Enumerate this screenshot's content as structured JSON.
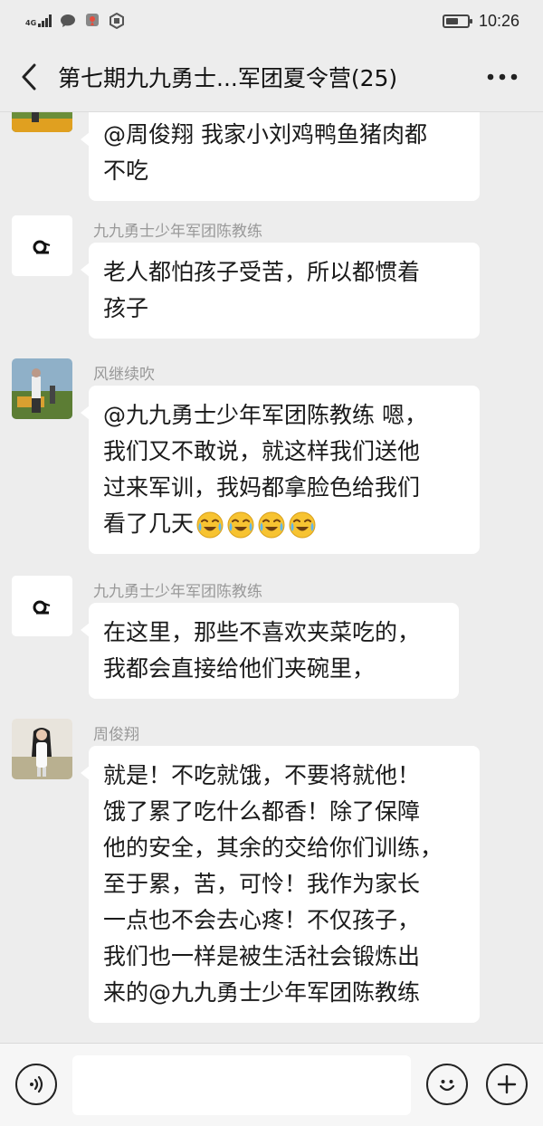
{
  "status_bar": {
    "network_type": "4G",
    "time": "10:26",
    "battery_level": 0.6
  },
  "header": {
    "title": "第七期九九勇士...军团夏令营(25)",
    "back_icon": "chevron-left-icon",
    "more_icon": "more-dots-icon"
  },
  "messages": [
    {
      "sender": "",
      "avatar": "photo-avatar-man",
      "lines": [
        "@周俊翔  我家小刘鸡鸭鱼猪肉都",
        "不吃"
      ]
    },
    {
      "sender": "九九勇士少年军团陈教练",
      "avatar": "logo-avatar",
      "lines": [
        "老人都怕孩子受苦，所以都惯着",
        "孩子"
      ]
    },
    {
      "sender": "风继续吹",
      "avatar": "photo-avatar-man",
      "lines": [
        "@九九勇士少年军团陈教练  嗯，",
        "我们又不敢说，就这样我们送他",
        "过来军训，我妈都拿脸色给我们",
        "看了几天"
      ],
      "emoji": [
        "crying-laughing-emoji",
        "crying-laughing-emoji",
        "crying-laughing-emoji",
        "crying-laughing-emoji"
      ]
    },
    {
      "sender": "九九勇士少年军团陈教练",
      "avatar": "logo-avatar",
      "lines": [
        "在这里，那些不喜欢夹菜吃的，",
        "我都会直接给他们夹碗里，"
      ]
    },
    {
      "sender": "周俊翔",
      "avatar": "photo-avatar-woman",
      "lines": [
        "就是！不吃就饿，不要将就他！",
        "饿了累了吃什么都香！除了保障",
        "他的安全，其余的交给你们训练，",
        "至于累，苦，可怜！我作为家长",
        "一点也不会去心疼！不仅孩子，",
        "我们也一样是被生活社会锻炼出",
        "来的@九九勇士少年军团陈教练"
      ]
    }
  ],
  "input_bar": {
    "voice_icon": "voice-icon",
    "emoji_icon": "emoji-icon",
    "plus_icon": "plus-icon",
    "text_value": ""
  },
  "colors": {
    "background": "#ededed",
    "bubble": "#ffffff",
    "sender_name": "#999999"
  }
}
